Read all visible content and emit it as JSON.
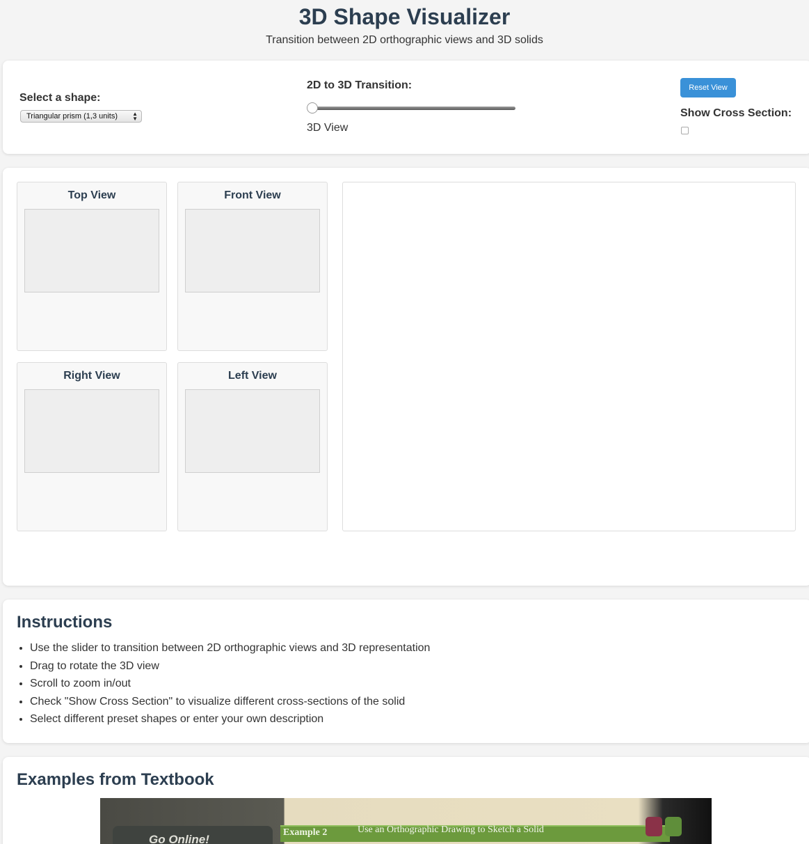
{
  "header": {
    "title": "3D Shape Visualizer",
    "subtitle": "Transition between 2D orthographic views and 3D solids"
  },
  "controls": {
    "shape_label": "Select a shape:",
    "shape_selected": "Triangular prism (1,3 units)",
    "transition_label": "2D to 3D Transition:",
    "transition_value": 0,
    "view_mode": "3D View",
    "reset_label": "Reset View",
    "cross_section_label": "Show Cross Section:",
    "cross_section_checked": false
  },
  "views": [
    {
      "title": "Top View"
    },
    {
      "title": "Front View"
    },
    {
      "title": "Right View"
    },
    {
      "title": "Left View"
    }
  ],
  "instructions": {
    "title": "Instructions",
    "items": [
      "Use the slider to transition between 2D orthographic views and 3D representation",
      "Drag to rotate the 3D view",
      "Scroll to zoom in/out",
      "Check \"Show Cross Section\" to visualize different cross-sections of the solid",
      "Select different preset shapes or enter your own description"
    ]
  },
  "examples": {
    "title": "Examples from Textbook",
    "photo": {
      "go_online": "Go Online!",
      "example_label": "Example 2",
      "banner_text": "Use an Orthographic Drawing to Sketch a Solid"
    }
  },
  "colors": {
    "accent": "#3a91d8",
    "heading": "#2c3e50",
    "background": "#f4f4f4"
  }
}
